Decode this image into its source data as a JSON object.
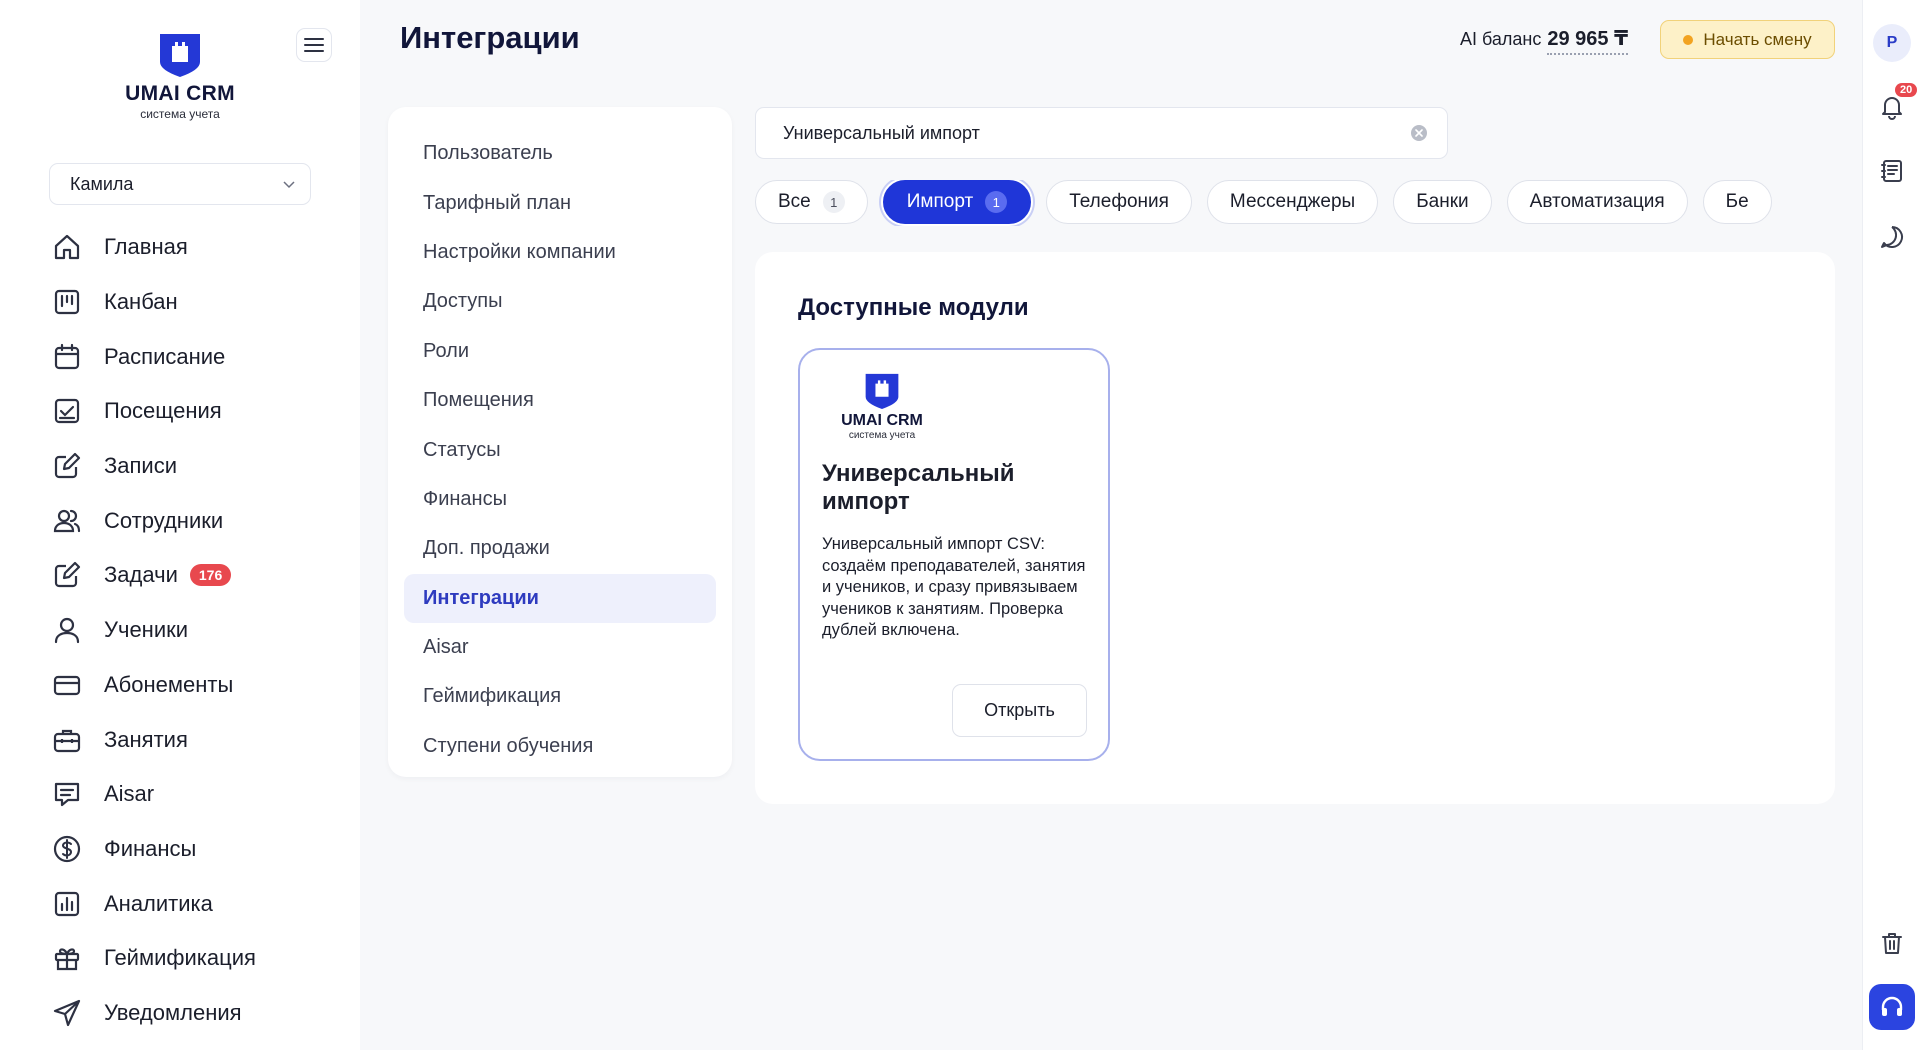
{
  "brand": {
    "name": "UMAI CRM",
    "subtitle": "система учета"
  },
  "sidebar": {
    "user": "Камила",
    "items": [
      {
        "label": "Главная",
        "icon": "home-icon"
      },
      {
        "label": "Канбан",
        "icon": "kanban-icon"
      },
      {
        "label": "Расписание",
        "icon": "calendar-icon"
      },
      {
        "label": "Посещения",
        "icon": "attendance-icon"
      },
      {
        "label": "Записи",
        "icon": "edit-icon"
      },
      {
        "label": "Сотрудники",
        "icon": "users-icon"
      },
      {
        "label": "Задачи",
        "icon": "tasks-icon",
        "badge": "176"
      },
      {
        "label": "Ученики",
        "icon": "user-icon"
      },
      {
        "label": "Абонементы",
        "icon": "card-icon"
      },
      {
        "label": "Занятия",
        "icon": "briefcase-icon"
      },
      {
        "label": "Aisar",
        "icon": "chat-icon"
      },
      {
        "label": "Финансы",
        "icon": "dollar-icon"
      },
      {
        "label": "Аналитика",
        "icon": "analytics-icon"
      },
      {
        "label": "Геймификация",
        "icon": "gift-icon"
      },
      {
        "label": "Уведомления",
        "icon": "send-icon"
      }
    ]
  },
  "header": {
    "title": "Интеграции",
    "ai_balance_label": "AI баланс",
    "ai_balance_value": "29 965 ₸",
    "shift_button": "Начать смену"
  },
  "rail": {
    "avatar": "Р",
    "notifications": "20"
  },
  "settings_menu": {
    "items": [
      "Пользователь",
      "Тарифный план",
      "Настройки компании",
      "Доступы",
      "Роли",
      "Помещения",
      "Статусы",
      "Финансы",
      "Доп. продажи",
      "Интеграции",
      "Aisar",
      "Геймификация",
      "Ступени обучения"
    ],
    "active": "Интеграции"
  },
  "search": {
    "value": "Универсальный импорт"
  },
  "chips": [
    {
      "label": "Все",
      "count": "1"
    },
    {
      "label": "Импорт",
      "count": "1",
      "active": true
    },
    {
      "label": "Телефония"
    },
    {
      "label": "Мессенджеры"
    },
    {
      "label": "Банки"
    },
    {
      "label": "Автоматизация"
    },
    {
      "label": "Бе"
    }
  ],
  "modules": {
    "title": "Доступные модули",
    "card": {
      "logo_name": "UMAI CRM",
      "logo_sub": "система учета",
      "title": "Универсальный импорт",
      "description": "Универсальный импорт CSV: создаём преподавателей, занятия и учеников, и сразу привязываем учеников к занятиям. Проверка дублей включена.",
      "button": "Открыть"
    }
  },
  "colors": {
    "accent": "#1f36d8",
    "badge": "#e8484e",
    "shift_bg": "#fdf1c8"
  }
}
